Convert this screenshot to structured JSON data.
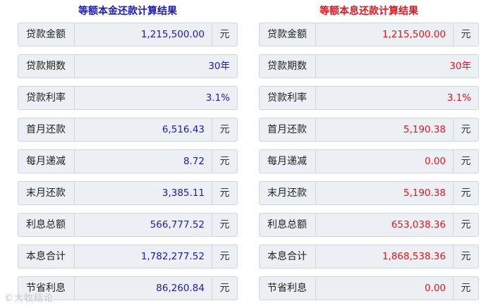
{
  "left": {
    "title": "等额本金还款计算结果",
    "rows": [
      {
        "label": "贷款金额",
        "value": "1,215,500.00",
        "unit": "元"
      },
      {
        "label": "贷款期数",
        "value": "30年",
        "unit": ""
      },
      {
        "label": "贷款利率",
        "value": "3.1%",
        "unit": ""
      },
      {
        "label": "首月还款",
        "value": "6,516.43",
        "unit": "元"
      },
      {
        "label": "每月递减",
        "value": "8.72",
        "unit": "元"
      },
      {
        "label": "末月还款",
        "value": "3,385.11",
        "unit": "元"
      },
      {
        "label": "利息总额",
        "value": "566,777.52",
        "unit": "元"
      },
      {
        "label": "本息合计",
        "value": "1,782,277.52",
        "unit": "元"
      },
      {
        "label": "节省利息",
        "value": "86,260.84",
        "unit": "元"
      }
    ]
  },
  "right": {
    "title": "等额本息还款计算结果",
    "rows": [
      {
        "label": "贷款金额",
        "value": "1,215,500.00",
        "unit": "元"
      },
      {
        "label": "贷款期数",
        "value": "30年",
        "unit": ""
      },
      {
        "label": "贷款利率",
        "value": "3.1%",
        "unit": ""
      },
      {
        "label": "首月还款",
        "value": "5,190.38",
        "unit": "元"
      },
      {
        "label": "每月递减",
        "value": "0.00",
        "unit": "元"
      },
      {
        "label": "末月还款",
        "value": "5,190.38",
        "unit": "元"
      },
      {
        "label": "利息总额",
        "value": "653,038.36",
        "unit": "元"
      },
      {
        "label": "本息合计",
        "value": "1,868,538.36",
        "unit": "元"
      },
      {
        "label": "节省利息",
        "value": "0.00",
        "unit": "元"
      }
    ]
  },
  "watermark": "©大牧结论",
  "colors": {
    "left_accent": "#1a19c8",
    "right_accent": "#e8141e"
  }
}
